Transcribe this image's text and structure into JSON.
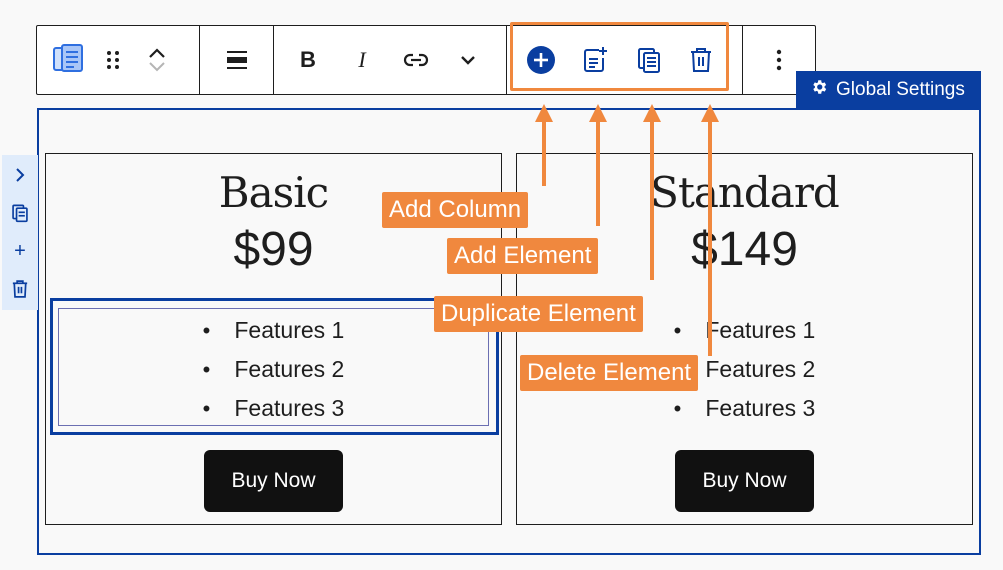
{
  "toolbar": {
    "block_icon": "pricing-table-icon",
    "drag_icon": "drag-handle-icon",
    "move_up_icon": "chevron-up-icon",
    "move_down_icon": "chevron-down-icon",
    "align_icon": "align-icon",
    "bold_label": "B",
    "italic_label": "I",
    "link_icon": "link-icon",
    "more_format_icon": "chevron-down-icon",
    "add_column_icon": "plus-circle-icon",
    "add_element_icon": "add-element-icon",
    "duplicate_icon": "duplicate-icon",
    "delete_icon": "trash-icon",
    "options_icon": "more-vertical-icon"
  },
  "global_settings": {
    "label": "Global Settings",
    "icon": "gear-icon"
  },
  "side_rail": {
    "items": [
      "chevron-right-icon",
      "duplicate-icon",
      "plus-icon",
      "trash-icon"
    ],
    "plus_label": "+"
  },
  "cards": [
    {
      "title": "Basic",
      "price": "$99",
      "features": [
        "Features 1",
        "Features 2",
        "Features 3"
      ],
      "button": "Buy Now"
    },
    {
      "title": "Standard",
      "price": "$149",
      "features": [
        "Features 1",
        "Features 2",
        "Features 3"
      ],
      "button": "Buy Now"
    }
  ],
  "callouts": {
    "add_column": "Add Column",
    "add_element": "Add Element",
    "duplicate_element": "Duplicate Element",
    "delete_element": "Delete Element"
  },
  "colors": {
    "accent": "#0a3ea0",
    "callout": "#f0883e",
    "button_bg": "#111111",
    "rail_bg": "#e0ecfb"
  }
}
